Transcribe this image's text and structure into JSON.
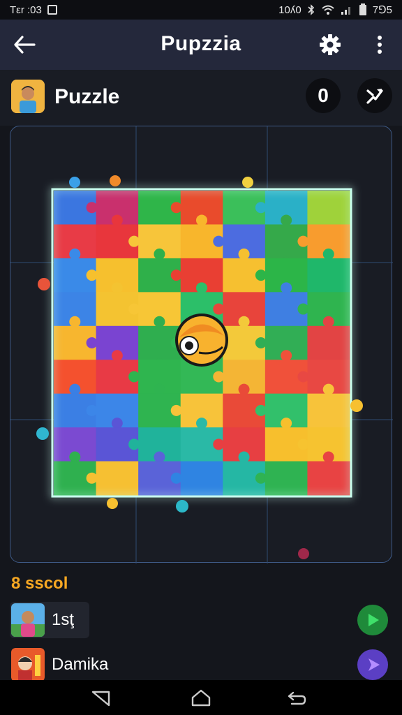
{
  "status_bar": {
    "time": "Tεr :03",
    "network_text": "10ʎ0",
    "battery_text": "7⅁5"
  },
  "app_bar": {
    "title": "Pupzzia",
    "icons": [
      "back-arrow-icon",
      "gear-icon",
      "more-vert-icon"
    ]
  },
  "sub_header": {
    "label": "Puzzle",
    "hint_glyph": "0",
    "icons": [
      "player-avatar",
      "shuffle-icon"
    ]
  },
  "board": {
    "grid": "6x8",
    "pieces": [
      [
        "#3b76e0",
        "#c9306d",
        "#2fb549",
        "#e94b2c",
        "#3bbf5a",
        "#2ab0c7",
        "#9fd23a"
      ],
      [
        "#e83b46",
        "#e8363c",
        "#f7c53a",
        "#f8b62c",
        "#4c6ce0",
        "#35a94a",
        "#f89c2e"
      ],
      [
        "#3a8ae8",
        "#f6c02e",
        "#2fb04a",
        "#e93f33",
        "#f6c030",
        "#2cb548",
        "#1fb76a"
      ],
      [
        "#3c84e6",
        "#f4c331",
        "#f7c636",
        "#2cbf69",
        "#e8443b",
        "#3f7fe2",
        "#2fb44f"
      ],
      [
        "#f7b62f",
        "#7a44d1",
        "#2fae4f",
        "#31b554",
        "#f3c93a",
        "#31ae55",
        "#e24444"
      ],
      [
        "#f4512e",
        "#e83a45",
        "#2fb54f",
        "#33b856",
        "#f4b535",
        "#f0513a",
        "#e84843"
      ],
      [
        "#3b7fe4",
        "#3c86e8",
        "#2fb450",
        "#f7c33a",
        "#e94a38",
        "#32c06b",
        "#f7c33a"
      ],
      [
        "#7b4ad1",
        "#5a55d6",
        "#20b39b",
        "#2ab9a6",
        "#e73f42",
        "#f7bf2d",
        "#f6c330"
      ],
      [
        "#2fb04f",
        "#f6c032",
        "#5a63d8",
        "#2f84e2",
        "#25b7a4",
        "#2fb352",
        "#e84343"
      ]
    ],
    "glow_color": "#a8ffe0",
    "center_piece_icon": "eye-emblem-icon"
  },
  "score": {
    "label": "8 sscol"
  },
  "players": [
    {
      "name": "1sţ",
      "button_icon": "play-icon",
      "button_color": "#1f8a3a"
    },
    {
      "name": "Damika",
      "button_icon": "diamond-play-icon",
      "button_color": "#5b3fc4",
      "badge_color": "#e85a2a"
    }
  ],
  "nav_bar": {
    "icons": [
      "back-triangle-icon",
      "home-icon",
      "recents-return-icon"
    ]
  }
}
